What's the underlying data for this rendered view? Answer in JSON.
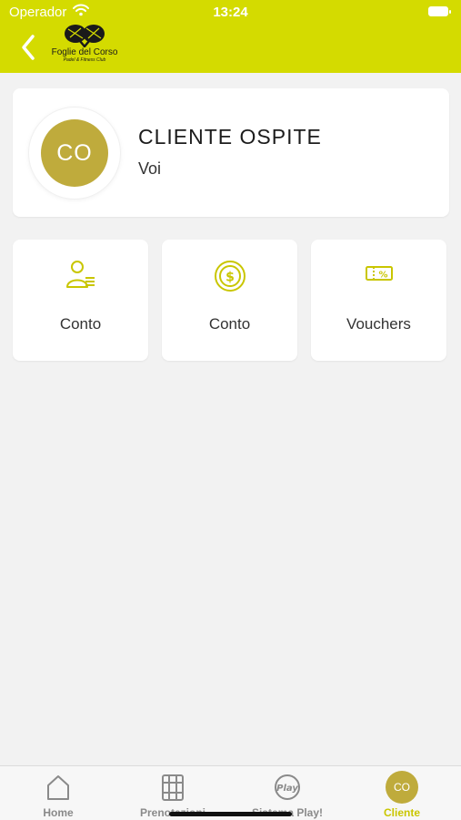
{
  "status_bar": {
    "carrier": "Operador",
    "time": "13:24"
  },
  "header": {
    "logo_name": "Foglie del Corso",
    "logo_sub": "Padel & Fitness Club"
  },
  "profile": {
    "initials": "CO",
    "name": "CLIENTE OSPITE",
    "subtitle": "Voi"
  },
  "tiles": [
    {
      "label": "Conto",
      "icon": "user-account-icon"
    },
    {
      "label": "Conto",
      "icon": "dollar-coin-icon"
    },
    {
      "label": "Vouchers",
      "icon": "voucher-ticket-icon"
    }
  ],
  "bottom_nav": [
    {
      "label": "Home",
      "icon": "home-icon"
    },
    {
      "label": "Prenotazioni",
      "icon": "calendar-court-icon"
    },
    {
      "label": "Sistema Play!",
      "icon": "play-logo-icon"
    },
    {
      "label": "Cliente",
      "icon": "avatar",
      "initials": "CO",
      "active": true
    }
  ],
  "colors": {
    "accent": "#d4db00",
    "avatar": "#bfab3c",
    "background": "#f2f2f2",
    "active_label": "#c9c600"
  }
}
